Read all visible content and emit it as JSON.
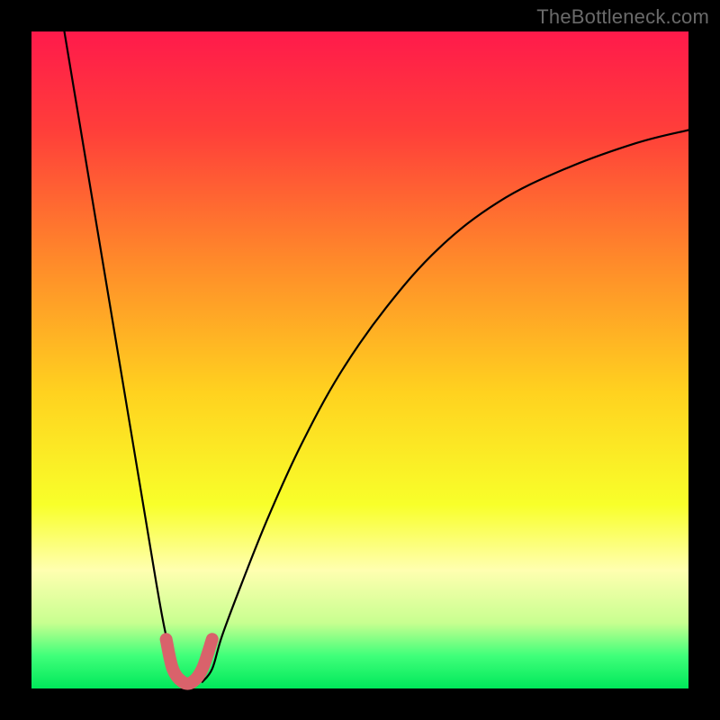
{
  "watermark": "TheBottleneck.com",
  "chart_data": {
    "type": "line",
    "title": "",
    "xlabel": "",
    "ylabel": "",
    "xlim": [
      0,
      100
    ],
    "ylim": [
      0,
      100
    ],
    "grid": false,
    "legend": false,
    "background_gradient": {
      "stops": [
        {
          "offset": 0.0,
          "color": "#ff1a4b"
        },
        {
          "offset": 0.15,
          "color": "#ff3e3a"
        },
        {
          "offset": 0.35,
          "color": "#ff8a2a"
        },
        {
          "offset": 0.55,
          "color": "#ffd21f"
        },
        {
          "offset": 0.72,
          "color": "#f8ff2a"
        },
        {
          "offset": 0.82,
          "color": "#ffffb0"
        },
        {
          "offset": 0.9,
          "color": "#c8ff90"
        },
        {
          "offset": 0.95,
          "color": "#40ff7a"
        },
        {
          "offset": 1.0,
          "color": "#00e85a"
        }
      ]
    },
    "series": [
      {
        "name": "left-branch",
        "x": [
          5,
          7,
          9,
          11,
          13,
          15,
          17,
          19,
          20.5,
          22,
          23
        ],
        "y": [
          100,
          88,
          76,
          64,
          52,
          40,
          28,
          16,
          8,
          3,
          1
        ]
      },
      {
        "name": "right-branch",
        "x": [
          26,
          27.5,
          29,
          32,
          36,
          41,
          47,
          54,
          62,
          71,
          81,
          92,
          100
        ],
        "y": [
          1,
          3,
          8,
          16,
          26,
          37,
          48,
          58,
          67,
          74,
          79,
          83,
          85
        ]
      },
      {
        "name": "valley-marker",
        "x": [
          20.5,
          21.5,
          23.0,
          24.5,
          26.0,
          27.5
        ],
        "y": [
          7.5,
          3.0,
          1.0,
          1.0,
          3.0,
          7.5
        ]
      }
    ],
    "annotations": []
  }
}
